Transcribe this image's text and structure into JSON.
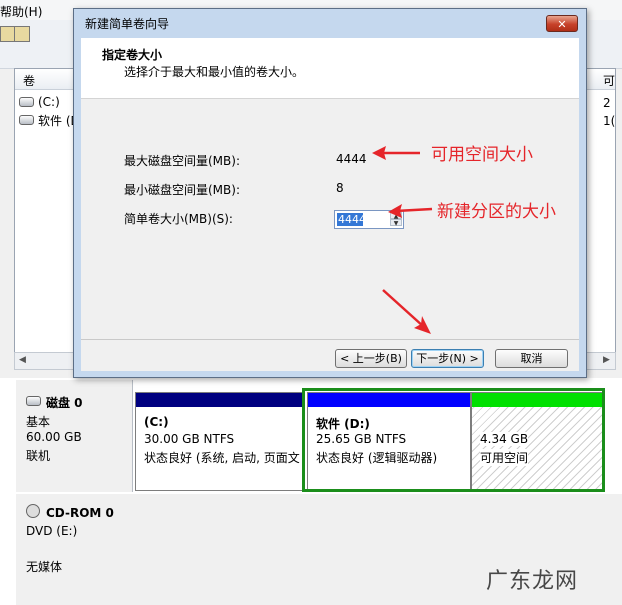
{
  "background": {
    "menu_help": "帮助(H)",
    "list_header_volume": "卷",
    "list_header_right": "可",
    "volumes": [
      {
        "name": "(C:)",
        "right": "2"
      },
      {
        "name": "软件 (D",
        "right": "1("
      }
    ]
  },
  "dialog": {
    "title": "新建简单卷向导",
    "close_label": "✕",
    "header_title": "指定卷大小",
    "header_subtitle": "选择介于最大和最小值的卷大小。",
    "max_label": "最大磁盘空间量(MB):",
    "max_value": "4444",
    "min_label": "最小磁盘空间量(MB):",
    "min_value": "8",
    "size_label": "简单卷大小(MB)(S):",
    "size_value": "4444",
    "back_button": "< 上一步(B)",
    "next_button": "下一步(N) >",
    "cancel_button": "取消"
  },
  "annotations": {
    "available_space": "可用空间大小",
    "new_partition_size": "新建分区的大小",
    "color": "#e5252a"
  },
  "disk0": {
    "title": "磁盘 0",
    "type": "基本",
    "size": "60.00 GB",
    "status": "联机",
    "partitions": [
      {
        "name": "(C:)",
        "size": "30.00 GB NTFS",
        "status": "状态良好 (系统, 启动, 页面文",
        "bar_color": "#000080"
      },
      {
        "name": "软件  (D:)",
        "size": "25.65 GB NTFS",
        "status": "状态良好 (逻辑驱动器)",
        "bar_color": "#0000ff"
      },
      {
        "name": "",
        "size": "4.34 GB",
        "status": "可用空间",
        "bar_color": "#00e000"
      }
    ]
  },
  "cdrom": {
    "title": "CD-ROM 0",
    "type": "DVD (E:)",
    "status": "无媒体"
  },
  "watermark": "广东龙网"
}
